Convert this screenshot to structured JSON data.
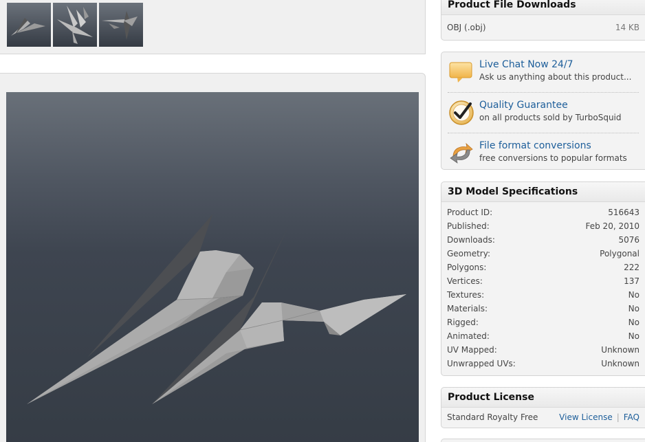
{
  "thumbnails": [
    {
      "icon": "model-thumbnail-1"
    },
    {
      "icon": "model-thumbnail-2"
    },
    {
      "icon": "model-thumbnail-3"
    }
  ],
  "downloads": {
    "title": "Product File Downloads",
    "files": [
      {
        "format": "OBJ (.obj)",
        "size": "14 KB"
      }
    ]
  },
  "services": {
    "live_chat": {
      "title": "Live Chat Now 24/7",
      "subtitle": "Ask us anything about this product...",
      "icon": "chat-bubble-icon"
    },
    "quality": {
      "title": "Quality Guarantee",
      "subtitle": "on all products sold by TurboSquid",
      "icon": "checkmark-badge-icon"
    },
    "conversions": {
      "title": "File format conversions",
      "subtitle": "free conversions to popular formats",
      "icon": "convert-arrows-icon"
    }
  },
  "specs": {
    "title": "3D Model Specifications",
    "rows": [
      {
        "label": "Product ID:",
        "value": "516643"
      },
      {
        "label": "Published:",
        "value": "Feb 20, 2010"
      },
      {
        "label": "Downloads:",
        "value": "5076"
      },
      {
        "label": "Geometry:",
        "value": "Polygonal"
      },
      {
        "label": "Polygons:",
        "value": "222"
      },
      {
        "label": "Vertices:",
        "value": "137"
      },
      {
        "label": "Textures:",
        "value": "No"
      },
      {
        "label": "Materials:",
        "value": "No"
      },
      {
        "label": "Rigged:",
        "value": "No"
      },
      {
        "label": "Animated:",
        "value": "No"
      },
      {
        "label": "UV Mapped:",
        "value": "Unknown"
      },
      {
        "label": "Unwrapped UVs:",
        "value": "Unknown"
      }
    ]
  },
  "license": {
    "title": "Product License",
    "type": "Standard Royalty Free",
    "view_link": "View License",
    "separator": "|",
    "faq_link": "FAQ"
  },
  "colors": {
    "link": "#1d5e9a",
    "viewer_bg_top": "#697079",
    "viewer_bg_bottom": "#353c45",
    "model_light": "#a8a8a8",
    "model_dark": "#4c4e52"
  }
}
